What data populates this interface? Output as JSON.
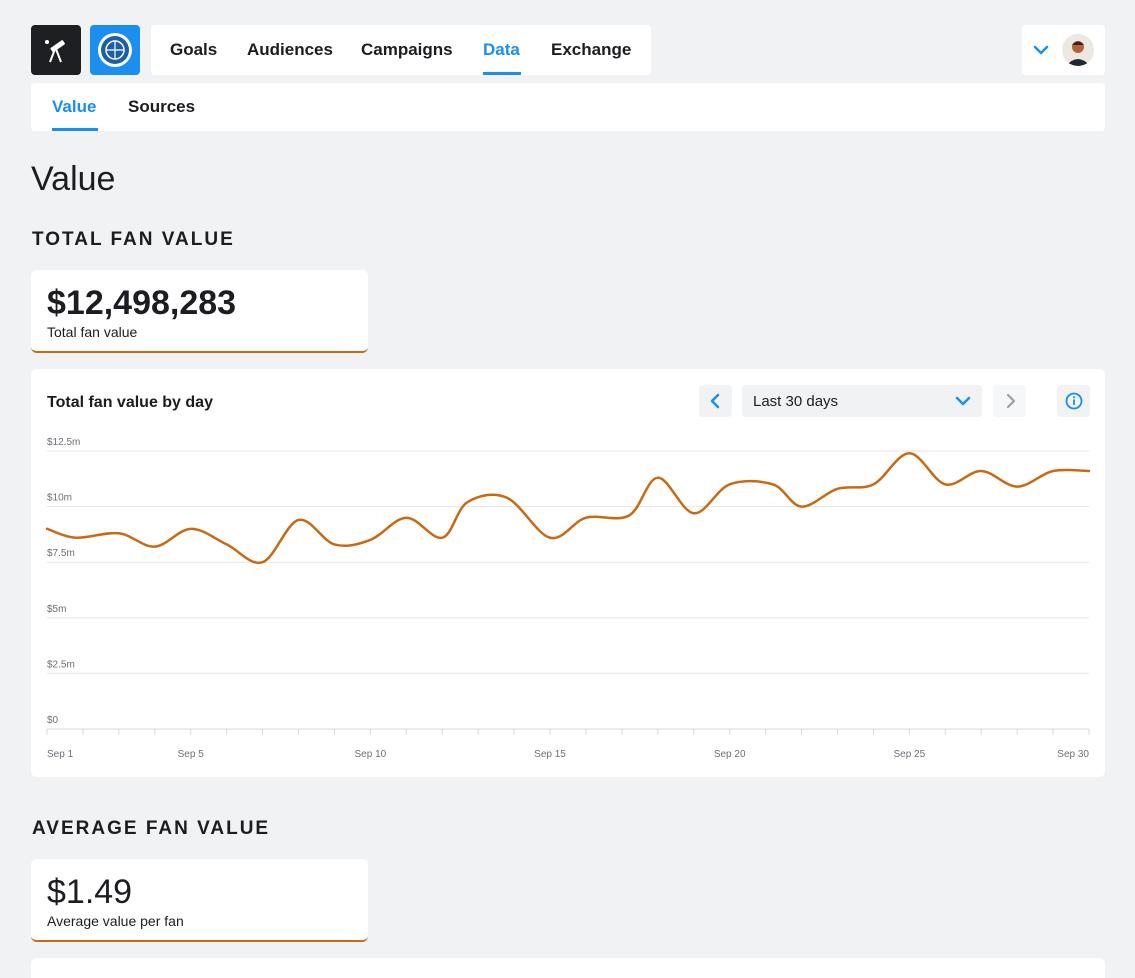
{
  "nav": {
    "items": [
      {
        "label": "Goals"
      },
      {
        "label": "Audiences"
      },
      {
        "label": "Campaigns"
      },
      {
        "label": "Data"
      },
      {
        "label": "Exchange"
      }
    ],
    "active": "Data"
  },
  "subnav": {
    "items": [
      {
        "label": "Value"
      },
      {
        "label": "Sources"
      }
    ],
    "active": "Value"
  },
  "page": {
    "title": "Value"
  },
  "total_section": {
    "heading": "TOTAL FAN VALUE",
    "value": "$12,498,283",
    "label": "Total fan value"
  },
  "chart_panel": {
    "title": "Total fan value by day",
    "range": "Last 30 days"
  },
  "average_section": {
    "heading": "AVERAGE FAN VALUE",
    "value": "$1.49",
    "label": "Average value per fan"
  },
  "colors": {
    "accent": "#1a8ff0",
    "line": "#c96a12",
    "text": "#1c1d21",
    "background": "#f1f2f4"
  },
  "chart_data": {
    "type": "line",
    "title": "Total fan value by day",
    "x_tick_labels": [
      "Sep 1",
      "Sep 5",
      "Sep 10",
      "Sep 15",
      "Sep 20",
      "Sep 25",
      "Sep 30"
    ],
    "x_tick_days": [
      1,
      5,
      10,
      15,
      20,
      25,
      30
    ],
    "y_tick_labels": [
      "$0",
      "$2.5m",
      "$5m",
      "$7.5m",
      "$10m",
      "$12.5m"
    ],
    "y_tick_values": [
      0,
      2.5,
      5,
      7.5,
      10,
      12.5
    ],
    "ylim": [
      0,
      12.5
    ],
    "xlim": [
      1,
      30
    ],
    "grid": true,
    "series": [
      {
        "values": [
          [
            1.0,
            9.0
          ],
          [
            1.8,
            8.6
          ],
          [
            3.0,
            8.8
          ],
          [
            4.0,
            8.2
          ],
          [
            5.0,
            9.0
          ],
          [
            6.0,
            8.3
          ],
          [
            7.0,
            7.5
          ],
          [
            8.0,
            9.4
          ],
          [
            9.0,
            8.3
          ],
          [
            10.0,
            8.5
          ],
          [
            11.0,
            9.5
          ],
          [
            12.0,
            8.6
          ],
          [
            12.7,
            10.2
          ],
          [
            13.8,
            10.4
          ],
          [
            15.0,
            8.6
          ],
          [
            16.0,
            9.5
          ],
          [
            17.2,
            9.6
          ],
          [
            18.0,
            11.3
          ],
          [
            19.0,
            9.7
          ],
          [
            20.0,
            11.0
          ],
          [
            21.2,
            11.0
          ],
          [
            22.0,
            10.0
          ],
          [
            23.0,
            10.8
          ],
          [
            24.0,
            11.0
          ],
          [
            25.0,
            12.4
          ],
          [
            26.0,
            11.0
          ],
          [
            27.0,
            11.6
          ],
          [
            28.0,
            10.9
          ],
          [
            29.0,
            11.6
          ],
          [
            30.0,
            11.6
          ]
        ]
      }
    ]
  }
}
